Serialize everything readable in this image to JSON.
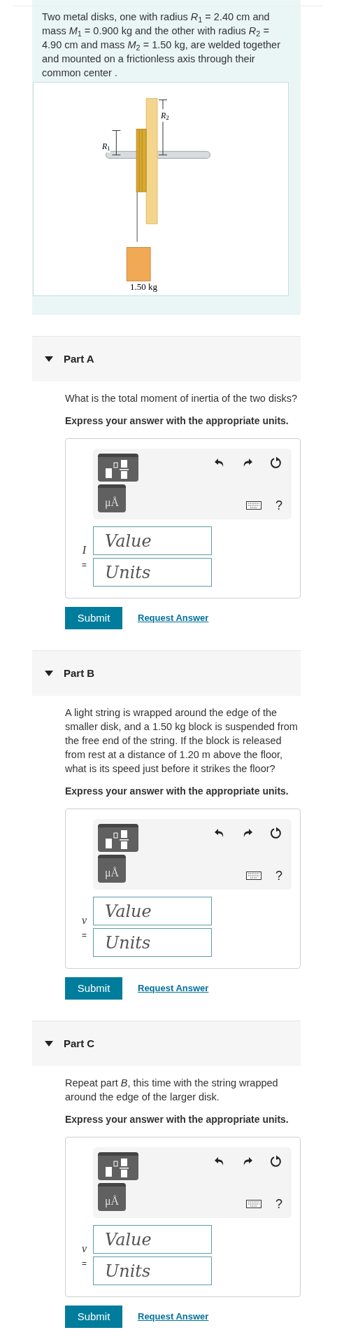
{
  "intro": {
    "text": "Two metal disks, one with radius *R*$_{1}$ = 2.40 cm and mass *M*$_{1}$ = 0.900 kg and the other with radius *R*$_{2}$ = 4.90 cm and mass *M*$_{2}$ = 1.50 kg, are welded together and mounted on a frictionless axis through their common center .",
    "figure": {
      "label_r1": "*R*$_{1}$",
      "label_r2": "*R*$_{2}$",
      "block_label": "1.50 kg"
    }
  },
  "parts": [
    {
      "title": "Part A",
      "expanded": true,
      "question": "What is the total moment of inertia of the two disks?",
      "instruction": "Express your answer with the appropriate units.",
      "units_key": "μÅ",
      "help": "?",
      "variable": "I",
      "equals": "=",
      "value_placeholder": "Value",
      "units_placeholder": "Units",
      "submit": "Submit",
      "request": "Request Answer"
    },
    {
      "title": "Part B",
      "expanded": true,
      "question": "A light string is wrapped around the edge of the smaller disk, and a 1.50 kg block is suspended from the free end of the string. If the block is released from rest at a distance of 1.20 m above the floor, what is its speed just before it strikes the floor?",
      "instruction": "Express your answer with the appropriate units.",
      "units_key": "μÅ",
      "help": "?",
      "variable": "v",
      "equals": "=",
      "value_placeholder": "Value",
      "units_placeholder": "Units",
      "submit": "Submit",
      "request": "Request Answer"
    },
    {
      "title": "Part C",
      "expanded": true,
      "question": "Repeat part *B*, this time with the string wrapped around the edge of the larger disk.",
      "instruction": "Express your answer with the appropriate units.",
      "units_key": "μÅ",
      "help": "?",
      "variable": "v",
      "equals": "=",
      "value_placeholder": "Value",
      "units_placeholder": "Units",
      "submit": "Submit",
      "request": "Request Answer"
    }
  ]
}
